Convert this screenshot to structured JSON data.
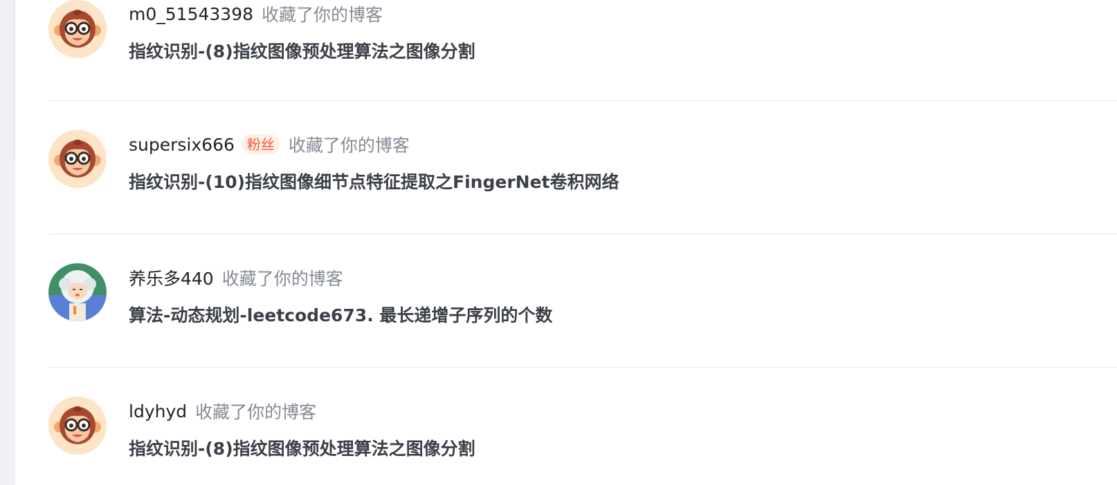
{
  "notifications": [
    {
      "username": "m0_51543398",
      "badge": "",
      "action": "收藏了你的博客",
      "title": "指纹识别-(8)指纹图像预处理算法之图像分割",
      "avatar": "monkey-avatar"
    },
    {
      "username": "supersix666",
      "badge": "粉丝",
      "action": "收藏了你的博客",
      "title": "指纹识别-(10)指纹图像细节点特征提取之FingerNet卷积网络",
      "avatar": "monkey-avatar"
    },
    {
      "username": "养乐多440",
      "badge": "",
      "action": "收藏了你的博客",
      "title": "算法-动态规划-leetcode673. 最长递增子序列的个数",
      "avatar": "sheep-avatar"
    },
    {
      "username": "ldyhyd",
      "badge": "",
      "action": "收藏了你的博客",
      "title": "指纹识别-(8)指纹图像预处理算法之图像分割",
      "avatar": "monkey-avatar"
    }
  ],
  "colors": {
    "username": "#222226",
    "action": "#858a95",
    "title": "#3b3f48",
    "badge_text": "#fc5531",
    "badge_bg": "#fff1e7",
    "divider": "#e6e8eb"
  }
}
